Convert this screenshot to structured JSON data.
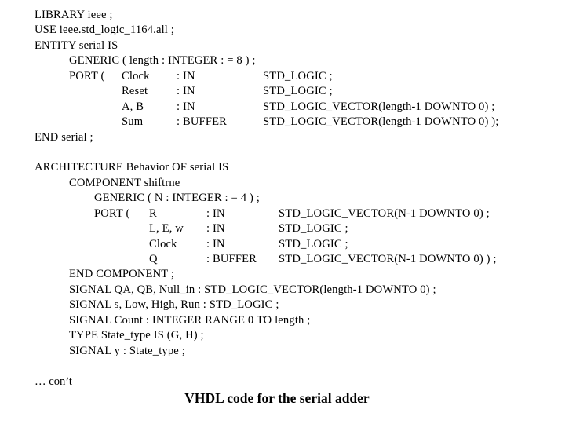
{
  "slide": {
    "caption": "VHDL code for the serial adder",
    "continuation_note": "… con’t",
    "background_color": "#ffffff",
    "text_color": "#000000"
  },
  "code": {
    "library_line": "LIBRARY ieee ;",
    "use_line": "USE ieee.std_logic_1164.all ;",
    "entity_line": "ENTITY serial IS",
    "entity_generic": "GENERIC ( length : INTEGER : = 8 ) ;",
    "entity_port_open": "PORT (",
    "entity_ports": [
      {
        "name": "Clock",
        "dir": ": IN",
        "type": "STD_LOGIC ;"
      },
      {
        "name": "Reset",
        "dir": ": IN",
        "type": "STD_LOGIC ;"
      },
      {
        "name": "A, B",
        "dir": ": IN",
        "type": "STD_LOGIC_VECTOR(length-1 DOWNTO 0) ;"
      },
      {
        "name": "Sum",
        "dir": ": BUFFER",
        "type": "STD_LOGIC_VECTOR(length-1 DOWNTO 0) );"
      }
    ],
    "end_entity": "END serial ;",
    "architecture_line": "ARCHITECTURE Behavior OF serial IS",
    "component_line": "COMPONENT shiftrne",
    "component_generic": "GENERIC ( N : INTEGER : = 4 ) ;",
    "component_port_open": "PORT (",
    "component_ports": [
      {
        "name": "R",
        "dir": ": IN",
        "type": "STD_LOGIC_VECTOR(N-1 DOWNTO 0) ;"
      },
      {
        "name": "L, E, w",
        "dir": ": IN",
        "type": "STD_LOGIC ;"
      },
      {
        "name": "Clock",
        "dir": ": IN",
        "type": "STD_LOGIC ;"
      },
      {
        "name": "Q",
        "dir": ": BUFFER",
        "type": "STD_LOGIC_VECTOR(N-1 DOWNTO 0) ) ;"
      }
    ],
    "end_component": "END COMPONENT ;",
    "declarations": [
      "SIGNAL QA, QB, Null_in : STD_LOGIC_VECTOR(length-1 DOWNTO 0) ;",
      "SIGNAL s, Low, High, Run : STD_LOGIC ;",
      "SIGNAL Count : INTEGER RANGE 0 TO length ;",
      "TYPE State_type IS (G, H) ;",
      "SIGNAL y : State_type ;"
    ]
  }
}
